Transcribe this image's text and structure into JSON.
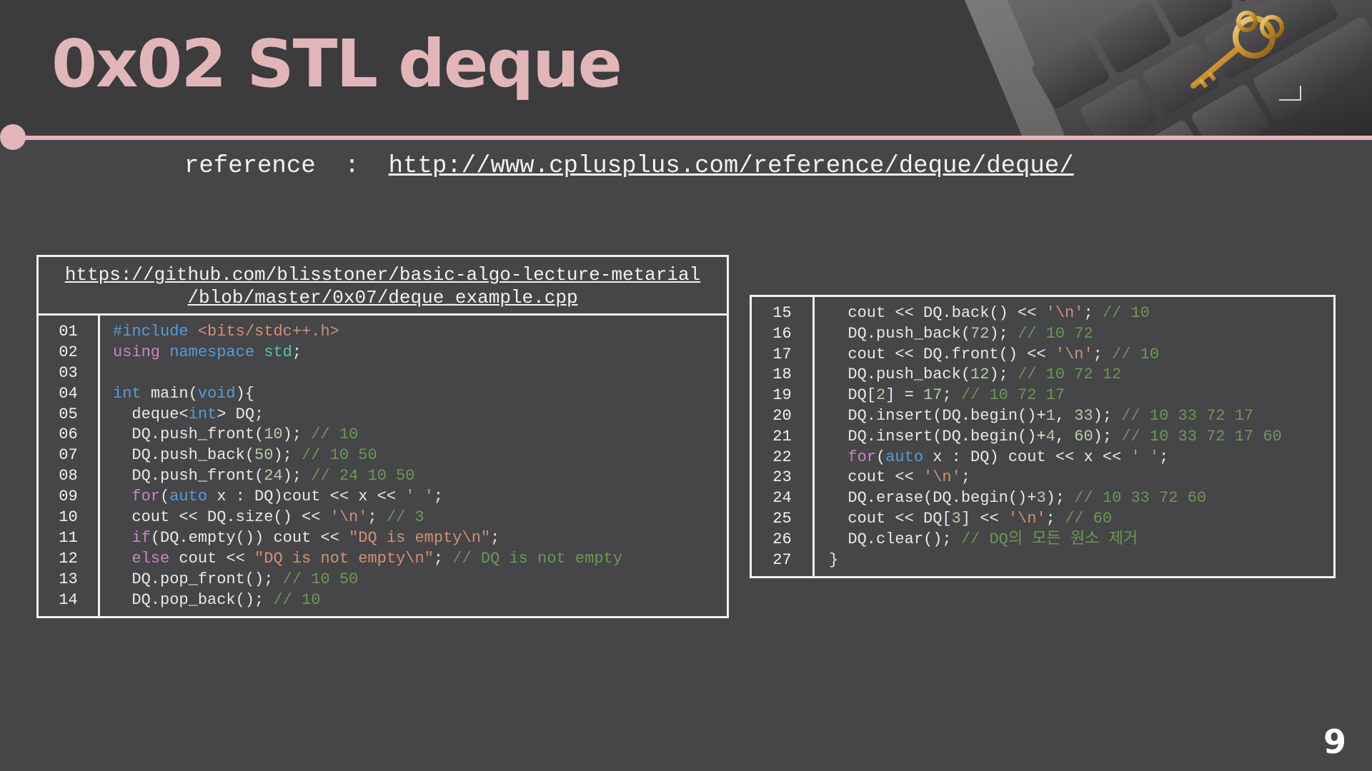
{
  "slide": {
    "title": "0x02  STL deque",
    "reference_prefix": "reference  :  ",
    "reference_url": "http://www.cplusplus.com/reference/deque/deque/",
    "page_number": "9",
    "accent_color": "#e2b6b9"
  },
  "left_box": {
    "source_line1": "https://github.com/blisstoner/basic-algo-lecture-metarial",
    "source_line2": "/blob/master/0x07/deque_example.cpp",
    "line_numbers": [
      "01",
      "02",
      "03",
      "04",
      "05",
      "06",
      "07",
      "08",
      "09",
      "10",
      "11",
      "12",
      "13",
      "14"
    ],
    "lines": [
      [
        {
          "t": "#include ",
          "c": "kw"
        },
        {
          "t": "<bits/stdc++.h>",
          "c": "str"
        }
      ],
      [
        {
          "t": "using ",
          "c": "ctl"
        },
        {
          "t": "namespace ",
          "c": "kw"
        },
        {
          "t": "std",
          "c": "ns"
        },
        {
          "t": ";",
          "c": ""
        }
      ],
      [],
      [
        {
          "t": "int ",
          "c": "kw"
        },
        {
          "t": "main(",
          "c": ""
        },
        {
          "t": "void",
          "c": "kw"
        },
        {
          "t": "){",
          "c": ""
        }
      ],
      [
        {
          "t": "  deque<",
          "c": ""
        },
        {
          "t": "int",
          "c": "kw"
        },
        {
          "t": "> DQ;",
          "c": ""
        }
      ],
      [
        {
          "t": "  DQ.push_front(",
          "c": ""
        },
        {
          "t": "10",
          "c": "num"
        },
        {
          "t": "); ",
          "c": ""
        },
        {
          "t": "// 10",
          "c": "cm"
        }
      ],
      [
        {
          "t": "  DQ.push_back(",
          "c": ""
        },
        {
          "t": "50",
          "c": "num"
        },
        {
          "t": "); ",
          "c": ""
        },
        {
          "t": "// 10 50",
          "c": "cm"
        }
      ],
      [
        {
          "t": "  DQ.push_front(",
          "c": ""
        },
        {
          "t": "24",
          "c": "num"
        },
        {
          "t": "); ",
          "c": ""
        },
        {
          "t": "// 24 10 50",
          "c": "cm"
        }
      ],
      [
        {
          "t": "  for",
          "c": "ctl"
        },
        {
          "t": "(",
          "c": ""
        },
        {
          "t": "auto",
          "c": "kw"
        },
        {
          "t": " x : DQ)cout << x << ",
          "c": ""
        },
        {
          "t": "' '",
          "c": "str"
        },
        {
          "t": ";",
          "c": ""
        }
      ],
      [
        {
          "t": "  cout << DQ.size() << ",
          "c": ""
        },
        {
          "t": "'\\n'",
          "c": "str"
        },
        {
          "t": "; ",
          "c": ""
        },
        {
          "t": "// 3",
          "c": "cm"
        }
      ],
      [
        {
          "t": "  if",
          "c": "ctl"
        },
        {
          "t": "(DQ.empty()) cout << ",
          "c": ""
        },
        {
          "t": "\"DQ is empty\\n\"",
          "c": "str"
        },
        {
          "t": ";",
          "c": ""
        }
      ],
      [
        {
          "t": "  else",
          "c": "ctl"
        },
        {
          "t": " cout << ",
          "c": ""
        },
        {
          "t": "\"DQ is not empty\\n\"",
          "c": "str"
        },
        {
          "t": "; ",
          "c": ""
        },
        {
          "t": "// DQ is not empty",
          "c": "cm"
        }
      ],
      [
        {
          "t": "  DQ.pop_front(); ",
          "c": ""
        },
        {
          "t": "// 10 50",
          "c": "cm"
        }
      ],
      [
        {
          "t": "  DQ.pop_back(); ",
          "c": ""
        },
        {
          "t": "// 10",
          "c": "cm"
        }
      ]
    ]
  },
  "right_box": {
    "line_numbers": [
      "15",
      "16",
      "17",
      "18",
      "19",
      "20",
      "21",
      "22",
      "23",
      "24",
      "25",
      "26",
      "27"
    ],
    "lines": [
      [
        {
          "t": "  cout << DQ.back() << ",
          "c": ""
        },
        {
          "t": "'\\n'",
          "c": "str"
        },
        {
          "t": "; ",
          "c": ""
        },
        {
          "t": "// 10",
          "c": "cm"
        }
      ],
      [
        {
          "t": "  DQ.push_back(",
          "c": ""
        },
        {
          "t": "72",
          "c": "num"
        },
        {
          "t": "); ",
          "c": ""
        },
        {
          "t": "// 10 72",
          "c": "cm"
        }
      ],
      [
        {
          "t": "  cout << DQ.front() << ",
          "c": ""
        },
        {
          "t": "'\\n'",
          "c": "str"
        },
        {
          "t": "; ",
          "c": ""
        },
        {
          "t": "// 10",
          "c": "cm"
        }
      ],
      [
        {
          "t": "  DQ.push_back(",
          "c": ""
        },
        {
          "t": "12",
          "c": "num"
        },
        {
          "t": "); ",
          "c": ""
        },
        {
          "t": "// 10 72 12",
          "c": "cm"
        }
      ],
      [
        {
          "t": "  DQ[",
          "c": ""
        },
        {
          "t": "2",
          "c": "num"
        },
        {
          "t": "] = ",
          "c": ""
        },
        {
          "t": "17",
          "c": "num"
        },
        {
          "t": "; ",
          "c": ""
        },
        {
          "t": "// 10 72 17",
          "c": "cm"
        }
      ],
      [
        {
          "t": "  DQ.insert(DQ.begin()+",
          "c": ""
        },
        {
          "t": "1",
          "c": "num"
        },
        {
          "t": ", ",
          "c": ""
        },
        {
          "t": "33",
          "c": "num"
        },
        {
          "t": "); ",
          "c": ""
        },
        {
          "t": "// 10 33 72 17",
          "c": "cm"
        }
      ],
      [
        {
          "t": "  DQ.insert(DQ.begin()+",
          "c": ""
        },
        {
          "t": "4",
          "c": "num"
        },
        {
          "t": ", ",
          "c": ""
        },
        {
          "t": "60",
          "c": "num"
        },
        {
          "t": "); ",
          "c": ""
        },
        {
          "t": "// 10 33 72 17 60",
          "c": "cm"
        }
      ],
      [
        {
          "t": "  for",
          "c": "ctl"
        },
        {
          "t": "(",
          "c": ""
        },
        {
          "t": "auto",
          "c": "kw"
        },
        {
          "t": " x : DQ) cout << x << ",
          "c": ""
        },
        {
          "t": "' '",
          "c": "str"
        },
        {
          "t": ";",
          "c": ""
        }
      ],
      [
        {
          "t": "  cout << ",
          "c": ""
        },
        {
          "t": "'\\n'",
          "c": "str"
        },
        {
          "t": ";",
          "c": ""
        }
      ],
      [
        {
          "t": "  DQ.erase(DQ.begin()+",
          "c": ""
        },
        {
          "t": "3",
          "c": "num"
        },
        {
          "t": "); ",
          "c": ""
        },
        {
          "t": "// 10 33 72 60",
          "c": "cm"
        }
      ],
      [
        {
          "t": "  cout << DQ[",
          "c": ""
        },
        {
          "t": "3",
          "c": "num"
        },
        {
          "t": "] << ",
          "c": ""
        },
        {
          "t": "'\\n'",
          "c": "str"
        },
        {
          "t": "; ",
          "c": ""
        },
        {
          "t": "// 60",
          "c": "cm"
        }
      ],
      [
        {
          "t": "  DQ.clear(); ",
          "c": ""
        },
        {
          "t": "// DQ의 모든 원소 제거",
          "c": "cm"
        }
      ],
      [
        {
          "t": "}",
          "c": ""
        }
      ]
    ]
  }
}
